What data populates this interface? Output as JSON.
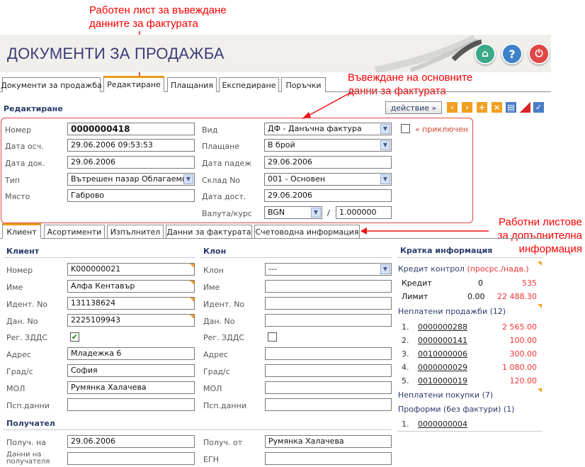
{
  "annotations": {
    "top_1": "Работен лист  за въвеждане",
    "top_2": "данните за фактурата",
    "mid_1": "Въвеждане на основните",
    "mid_2": "данни за фактурата",
    "right_1": "Работни листове",
    "right_2": "за допълнителна",
    "right_3": "информация"
  },
  "header": {
    "title": "ДОКУМЕНТИ ЗА ПРОДАЖБА",
    "buttons": [
      "home-icon",
      "help-icon",
      "power-icon"
    ]
  },
  "tabs": [
    "Документи за продажба",
    "Редактиране",
    "Плащания",
    "Експедиране",
    "Поръчки"
  ],
  "section": {
    "title": "Редактиране"
  },
  "toolbar": {
    "action_label": "действие »"
  },
  "doc": {
    "number_label": "Номер",
    "number": "0000000418",
    "acc_date_label": "Дата осч.",
    "acc_date": "29.06.2006 09:53:53",
    "doc_date_label": "Дата док.",
    "doc_date": "29.06.2006",
    "type_label": "Тип",
    "type": "Вътрешен пазар Облагаеми сд",
    "place_label": "Място",
    "place": "Габрово",
    "kind_label": "Вид",
    "kind": "ДФ - Данъчна фактура",
    "payment_label": "Плащане",
    "payment": "В брой",
    "due_label": "Дата падеж",
    "due": "29.06.2006",
    "warehouse_label": "Склад No",
    "warehouse": "001 - Основен",
    "delivery_label": "Дата дост.",
    "delivery": "29.06.2006",
    "currency_label": "Валута/курс",
    "currency": "BGN",
    "slash": "/",
    "rate": "1.000000",
    "closed_label": "« приключен"
  },
  "subtabs": [
    "Клиент",
    "Асортименти",
    "Изпълнител",
    "Данни за фактурата",
    "Счетоводна информация"
  ],
  "client": {
    "title": "Клиент",
    "number_label": "Номер",
    "number": "K000000021",
    "name_label": "Име",
    "name": "Алфа Кентавър",
    "ident_label": "Идент. No",
    "ident": "131138624",
    "tax_label": "Дан. No",
    "tax": "2225109943",
    "vat_label": "Рег. ЗДДС",
    "vat_mark": "✔",
    "address_label": "Адрес",
    "address": "Младежка 6",
    "city_label": "Град/с",
    "city": "София",
    "mol_label": "МОЛ",
    "mol": "Румянка Халачева",
    "passport_label": "Псп.данни"
  },
  "branch": {
    "title": "Клон",
    "branch_label": "Клон",
    "branch": "---",
    "name_label": "Име",
    "ident_label": "Идент. No",
    "tax_label": "Дан. No",
    "vat_label": "Рег. ЗДДС",
    "address_label": "Адрес",
    "city_label": "Град/с",
    "mol_label": "МОЛ",
    "passport_label": "Псп.данни"
  },
  "receiver": {
    "title": "Получател",
    "received_by_label": "Получ. на",
    "received_by": "29.06.2006",
    "received_from_label": "Получ. от",
    "received_from": "Румянка Халачева",
    "data_label_1": "Данни на",
    "data_label_2": "получателя",
    "egn_label": "ЕГН"
  },
  "info": {
    "title": "Кратка информация",
    "credit_control": "Кредит контрол",
    "credit_control_sub": "(просрс./надв.)",
    "credit_label": "Кредит",
    "credit_val": "0",
    "credit_red": "535",
    "limit_label": "Лимит",
    "limit_val": "0.00",
    "limit_red": "22 488.30",
    "unpaid_sales": "Неплатени продажби (12)",
    "sales": [
      {
        "n": "1.",
        "doc": "0000000288",
        "amt": "2 565.00"
      },
      {
        "n": "2.",
        "doc": "0000000141",
        "amt": "100.00"
      },
      {
        "n": "3.",
        "doc": "0010000006",
        "amt": "300.00"
      },
      {
        "n": "4.",
        "doc": "0000000029",
        "amt": "1 080.00"
      },
      {
        "n": "5.",
        "doc": "0010000019",
        "amt": "120.00"
      }
    ],
    "unpaid_purchases": "Неплатени покупки (7)",
    "proforma": "Проформи (без фактури) (1)",
    "proforma_item_n": "1.",
    "proforma_item": "0000000004"
  }
}
